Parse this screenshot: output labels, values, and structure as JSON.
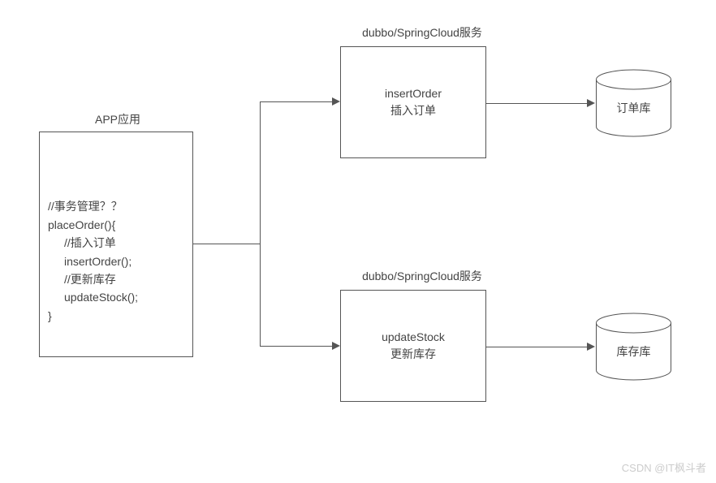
{
  "app": {
    "title": "APP应用",
    "code_line1": "//事务管理？？",
    "code_line2": "placeOrder(){",
    "code_line3": "//插入订单",
    "code_line4": "insertOrder();",
    "code_line5": "//更新库存",
    "code_line6": "updateStock();",
    "code_line7": "}"
  },
  "service1": {
    "title": "dubbo/SpringCloud服务",
    "line1": "insertOrder",
    "line2": "插入订单"
  },
  "service2": {
    "title": "dubbo/SpringCloud服务",
    "line1": "updateStock",
    "line2": "更新库存"
  },
  "db1": {
    "label": "订单库"
  },
  "db2": {
    "label": "库存库"
  },
  "watermark": "CSDN @IT枫斗者"
}
